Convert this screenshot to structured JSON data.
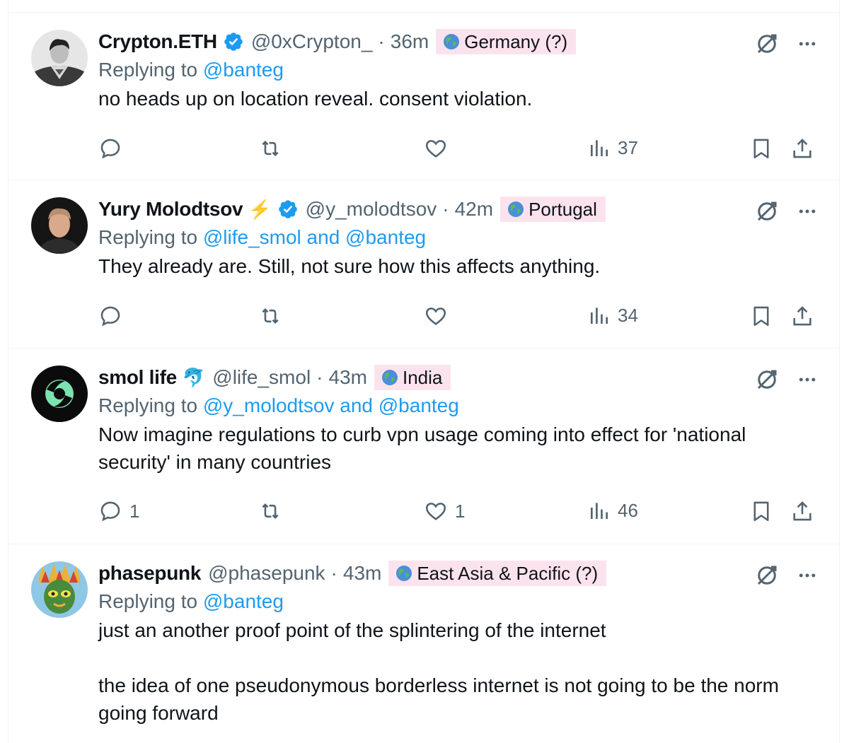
{
  "colors": {
    "accent": "#1d9bf0",
    "muted": "#536471",
    "badge": "#fbe3ee",
    "text": "#0f1419"
  },
  "tweets": [
    {
      "name": "Crypton.ETH",
      "verified": true,
      "emoji": "",
      "handle": "@0xCrypton_",
      "time": "36m",
      "location": "Germany (?)",
      "replying_prefix": "Replying to ",
      "replying_to": "@banteg",
      "text": "no heads up on location reveal. consent violation.",
      "reply_count": "",
      "retweet_count": "",
      "like_count": "",
      "views": "37",
      "avatar_icon": "superhero-avatar"
    },
    {
      "name": "Yury Molodtsov",
      "verified": true,
      "emoji": "⚡",
      "handle": "@y_molodtsov",
      "time": "42m",
      "location": "Portugal",
      "replying_prefix": "Replying to ",
      "replying_to": "@life_smol and @banteg",
      "text": "They already are. Still, not sure how this affects anything.",
      "reply_count": "",
      "retweet_count": "",
      "like_count": "",
      "views": "34",
      "avatar_icon": "person-photo-avatar"
    },
    {
      "name": "smol life",
      "verified": false,
      "emoji": "🐬",
      "handle": "@life_smol",
      "time": "43m",
      "location": "India",
      "replying_prefix": "Replying to ",
      "replying_to": "@y_molodtsov and @banteg",
      "text": "Now imagine regulations to curb vpn usage coming into effect for 'national security' in many countries",
      "reply_count": "1",
      "retweet_count": "",
      "like_count": "1",
      "views": "46",
      "avatar_icon": "swirl-logo-avatar"
    },
    {
      "name": "phasepunk",
      "verified": false,
      "emoji": "",
      "handle": "@phasepunk",
      "time": "43m",
      "location": "East Asia & Pacific (?)",
      "replying_prefix": "Replying to ",
      "replying_to": "@banteg",
      "text": "just an another proof point of the splintering of the internet\n\nthe idea of one pseudonymous borderless internet is not going to be the norm going forward",
      "avatar_icon": "tribal-mask-avatar"
    }
  ]
}
